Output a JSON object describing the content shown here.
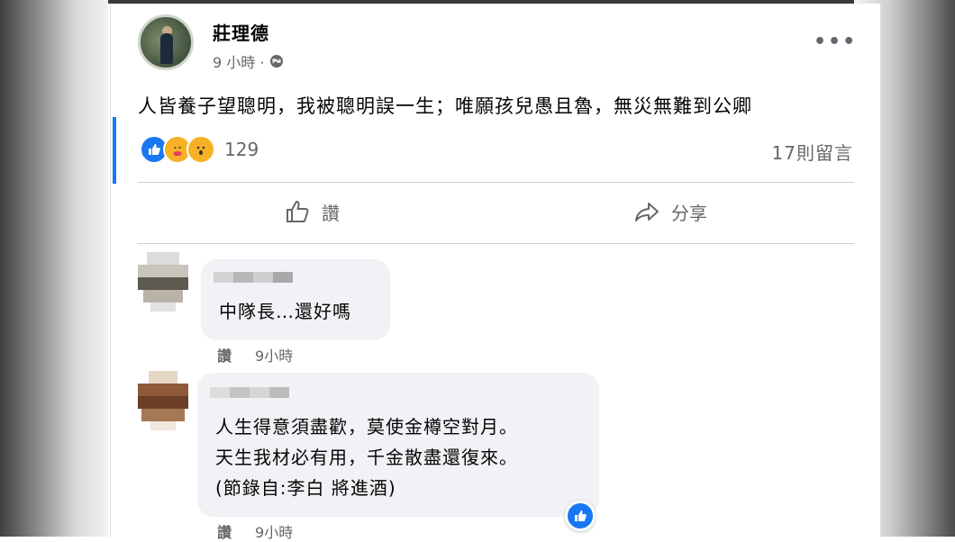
{
  "post": {
    "author": "莊理德",
    "time": "9 小時 ·",
    "privacy_icon": "globe-icon",
    "text": "人皆養子望聰明，我被聰明誤一生；唯願孩兒愚且魯，無災無難到公卿",
    "reaction_count": "129",
    "comments_count": "17則留言",
    "more_icon": "more-dots-icon"
  },
  "actions": {
    "like_label": "讚",
    "share_label": "分享"
  },
  "comments": [
    {
      "text_lines": [
        "中隊長…還好嗎"
      ],
      "like_label": "讚",
      "time": "9小時"
    },
    {
      "text_lines": [
        "人生得意須盡歡，莫使金樽空對月。",
        "天生我材必有用，千金散盡還復來。",
        "(節錄自:李白 將進酒)"
      ],
      "like_label": "讚",
      "time": "9小時"
    }
  ],
  "colors": {
    "accent": "#1877f2",
    "bubble": "#f0f2f5",
    "secondary_text": "#65676b"
  }
}
